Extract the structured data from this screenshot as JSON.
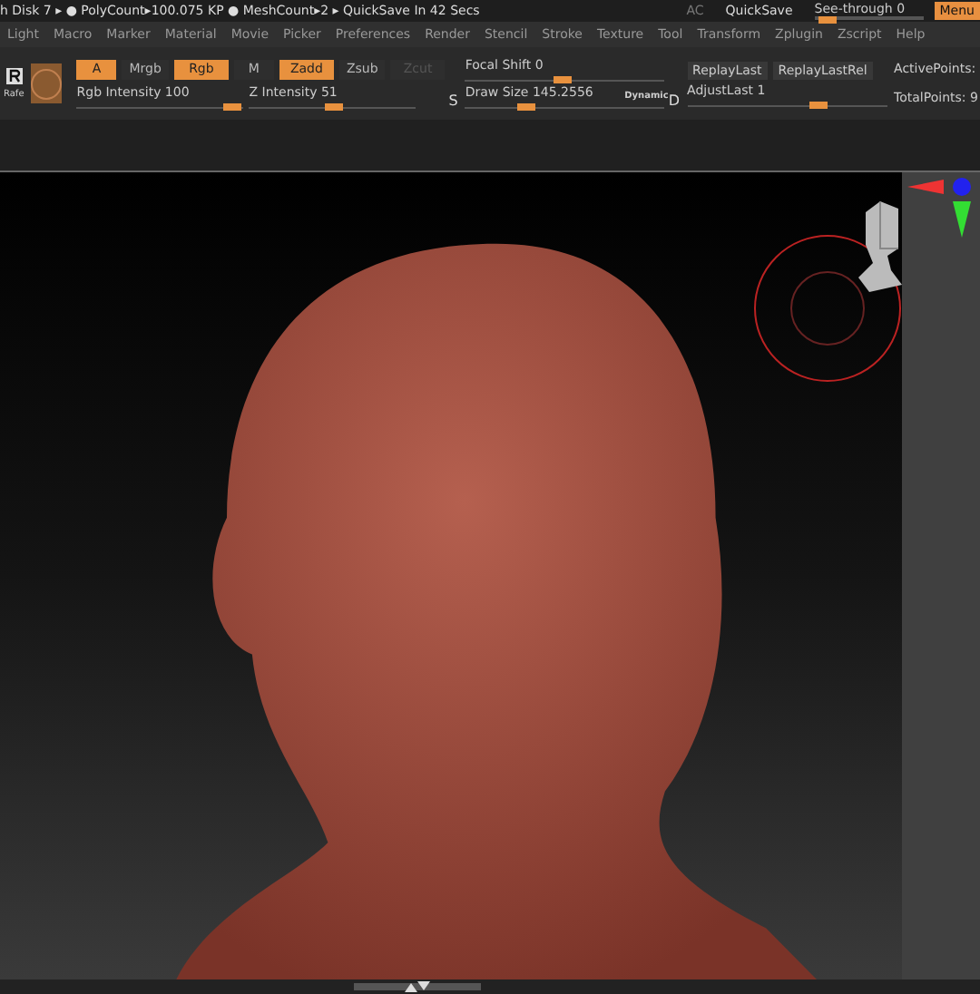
{
  "status_bar": {
    "text": "h Disk 7 ▸ ● PolyCount▸100.075 KP ● MeshCount▸2 ▸ QuickSave In 42 Secs",
    "ac": "AC",
    "quicksave": "QuickSave",
    "see_through": {
      "label": "See-through  0",
      "level": 0.05
    },
    "menu_button": "Menu"
  },
  "menu": [
    "Light",
    "Macro",
    "Marker",
    "Material",
    "Movie",
    "Picker",
    "Preferences",
    "Render",
    "Stencil",
    "Stroke",
    "Texture",
    "Tool",
    "Transform",
    "Zplugin",
    "Zscript",
    "Help"
  ],
  "tool_label": "Rafe",
  "toggles": [
    {
      "label": "A",
      "selected": true,
      "disabled": false
    },
    {
      "label": "Mrgb",
      "selected": false,
      "disabled": false
    },
    {
      "label": "Rgb",
      "selected": true,
      "disabled": false
    },
    {
      "label": "M",
      "selected": false,
      "disabled": false
    },
    {
      "label": "Zadd",
      "selected": true,
      "disabled": false
    },
    {
      "label": "Zsub",
      "selected": false,
      "disabled": false
    },
    {
      "label": "Zcut",
      "selected": false,
      "disabled": true
    }
  ],
  "intensity_sliders": [
    {
      "label": "Rgb Intensity",
      "value": "100",
      "level": 1.0
    },
    {
      "label": "Z Intensity",
      "value": "51",
      "level": 0.51
    }
  ],
  "draw_sliders": [
    {
      "label": "Focal Shift",
      "value": "0",
      "level": 0.5
    },
    {
      "label": "Draw Size",
      "value": "145.2556",
      "level": 0.3
    }
  ],
  "dynamic": "Dynamic",
  "s_key": "S",
  "d_key": "D",
  "replay": [
    "ReplayLast",
    "ReplayLastRel"
  ],
  "adjust_last": {
    "label": "AdjustLast",
    "value": "1",
    "level": 0.7
  },
  "points": [
    "ActivePoints:",
    "TotalPoints: 9"
  ]
}
